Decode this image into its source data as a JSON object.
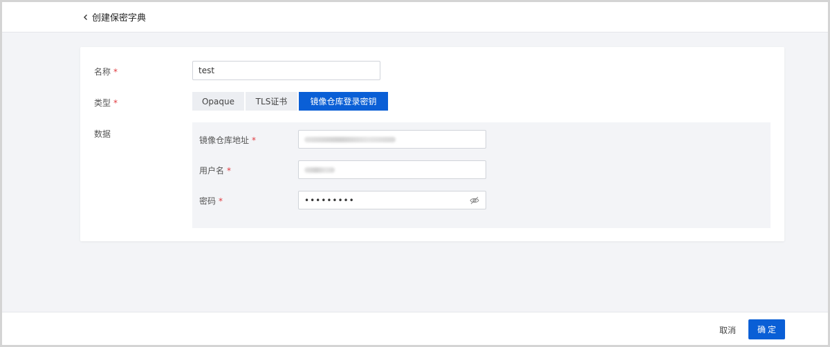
{
  "header": {
    "back_icon": "chevron-left-icon",
    "title": "创建保密字典"
  },
  "form": {
    "name": {
      "label": "名称",
      "required_mark": "*",
      "value": "test"
    },
    "type": {
      "label": "类型",
      "required_mark": "*",
      "options": [
        "Opaque",
        "TLS证书",
        "镜像仓库登录密钥"
      ],
      "selected": "镜像仓库登录密钥"
    },
    "data": {
      "label": "数据",
      "fields": {
        "registry": {
          "label": "镜像仓库地址",
          "required_mark": "*",
          "value_obscured": true
        },
        "username": {
          "label": "用户名",
          "required_mark": "*",
          "value_obscured": true
        },
        "password": {
          "label": "密码",
          "required_mark": "*",
          "value": "•••••••••",
          "toggle_icon": "eye-off-icon"
        }
      }
    }
  },
  "footer": {
    "cancel_label": "取消",
    "confirm_label": "确定"
  },
  "colors": {
    "primary": "#0a5fd6",
    "required": "#e0393e",
    "background": "#f3f4f7"
  }
}
